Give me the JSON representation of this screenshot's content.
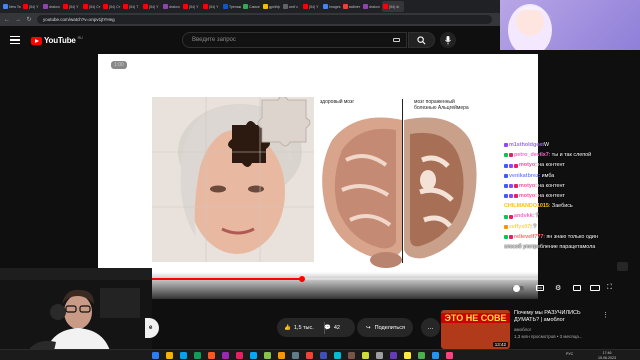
{
  "browser": {
    "tabs": [
      {
        "label": "New Ta",
        "color": "#4285f4"
      },
      {
        "label": "(54) Y",
        "color": "#ff0000"
      },
      {
        "label": "drakon",
        "color": "#8e44ad"
      },
      {
        "label": "(54) Y",
        "color": "#ff0000"
      },
      {
        "label": "(54) Ст",
        "color": "#ff0000"
      },
      {
        "label": "(54) Ст",
        "color": "#ff0000"
      },
      {
        "label": "(54) Т",
        "color": "#ff0000"
      },
      {
        "label": "(54) Y",
        "color": "#ff0000"
      },
      {
        "label": "drakon",
        "color": "#8e44ad"
      },
      {
        "label": "(54) Y",
        "color": "#ff0000"
      },
      {
        "label": "(54) Y",
        "color": "#ff0000"
      },
      {
        "label": "Тренаж",
        "color": "#0b57d0"
      },
      {
        "label": "Самое",
        "color": "#34a853"
      },
      {
        "label": "дрейф",
        "color": "#fbbc05"
      },
      {
        "label": "wolf с",
        "color": "#5f6368"
      },
      {
        "label": "(54) Y",
        "color": "#ff0000"
      },
      {
        "label": "Images",
        "color": "#4285f4"
      },
      {
        "label": "вайлет",
        "color": "#ea4335"
      },
      {
        "label": "drakon",
        "color": "#8e44ad"
      },
      {
        "label": "(54) dr",
        "color": "#ff0000",
        "active": true
      }
    ],
    "url": "youtube.com/watch?v=xnpv1jtYHeg"
  },
  "youtube": {
    "logo_text": "YouTube",
    "region": "RU",
    "search_placeholder": "Введите запрос"
  },
  "player": {
    "time_badge": "1:00",
    "slide": {
      "healthy_label": "здоровый мозг",
      "alz_label_line1": "мозг пораженный",
      "alz_label_line2": "болезнью Альцгеймера"
    },
    "progress": 0.394
  },
  "actions": {
    "subscribe_label": "е",
    "likes": "1,5 тыс.",
    "comments": "42",
    "share_label": "Поделиться",
    "more_label": "..."
  },
  "recommended": {
    "thumb_text": "ЭТО НЕ СОВЕ",
    "duration": "13:42",
    "title": "Почему мы РАЗУЧИЛИСЬ ДУМАТЬ? | амоблог",
    "channel": "амоблог",
    "meta": "1,3 млн просмотров • 3 месяца..."
  },
  "chat": [
    {
      "user": "m1stholdgeet",
      "user_color": "#9b6bff",
      "msg": "W",
      "badges": [
        "#9147ff"
      ]
    },
    {
      "user": "petro_devilx7",
      "user_color": "#ff66cc",
      "msg": ": ты и так слепой",
      "badges": [
        "#00c853",
        "#e91e63"
      ]
    },
    {
      "user": "motyo",
      "user_color": "#ff4fa0",
      "msg": ": на контент",
      "badges": [
        "#3d5afe",
        "#9147ff",
        "#e91e63"
      ]
    },
    {
      "user": "venikatbrez",
      "user_color": "#7b8cff",
      "msg": ": имба",
      "badges": [
        "#3d5afe"
      ]
    },
    {
      "user": "motyo",
      "user_color": "#ff4fa0",
      "msg": ": на контент",
      "badges": [
        "#3d5afe",
        "#9147ff",
        "#e91e63"
      ]
    },
    {
      "user": "motyo",
      "user_color": "#ff4fa0",
      "msg": ": на контент",
      "badges": [
        "#3d5afe",
        "#9147ff",
        "#e91e63"
      ]
    },
    {
      "user": "CHILMANDO1015",
      "user_color": "#ffc107",
      "msg": ": Заебись",
      "badges": []
    },
    {
      "user": "andvkk",
      "user_color": "#ff66cc",
      "msg": ": ?",
      "badges": [
        "#00c853",
        "#e91e63"
      ]
    },
    {
      "user": "zeffyx07",
      "user_color": "#ffd740",
      "msg": ": ?",
      "badges": [
        "#ff9100"
      ]
    },
    {
      "user": "relievelf777",
      "user_color": "#ff6b6b",
      "msg": ": ян знаю только один",
      "badges": [
        "#00c853",
        "#e91e63"
      ]
    },
    {
      "user": "",
      "user_color": "#ffffff",
      "msg": "способ употребление парацетамола",
      "badges": []
    }
  ],
  "taskbar": {
    "icons": [
      "#2d7df6",
      "#f4b400",
      "#00a4ef",
      "#0f9d58",
      "#ff5722",
      "#9c27b0",
      "#e91e63",
      "#03a9f4",
      "#8bc34a",
      "#ff9800",
      "#607d8b",
      "#f44336",
      "#3f51b5",
      "#00bcd4",
      "#795548",
      "#cddc39",
      "#9e9e9e",
      "#673ab7",
      "#ffeb3b",
      "#4caf50",
      "#2196f3",
      "#ff4081"
    ],
    "lang": "РУС",
    "time": "17:46",
    "date": "15.06.2023"
  }
}
